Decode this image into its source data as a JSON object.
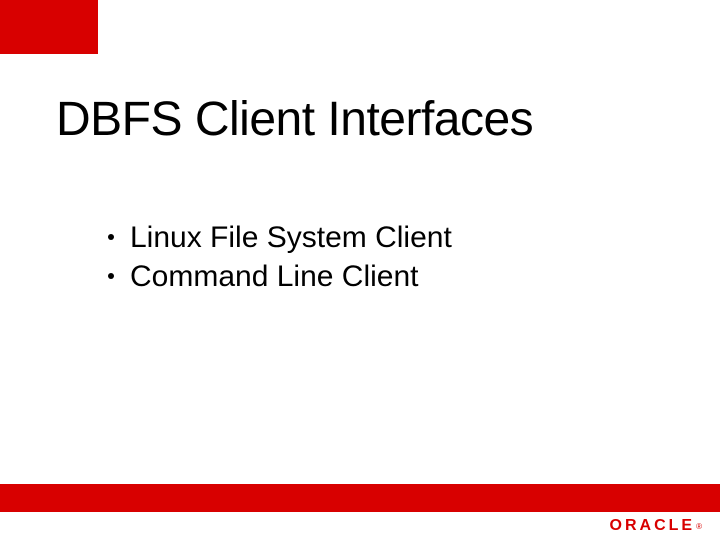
{
  "title": "DBFS Client Interfaces",
  "bullets": [
    "Linux File System Client",
    "Command Line Client"
  ],
  "logo": {
    "text": "ORACLE",
    "reg": "®"
  },
  "colors": {
    "brand_red": "#d80000"
  }
}
